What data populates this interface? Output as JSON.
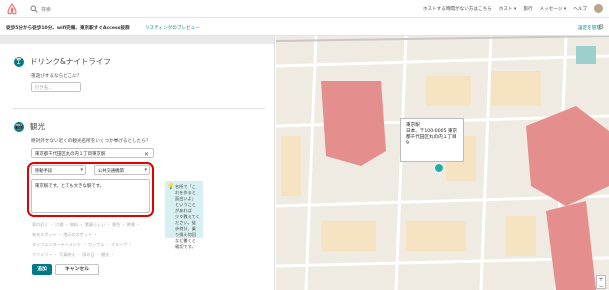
{
  "nav": {
    "search_placeholder": "検索",
    "links": [
      "ホストする時間がない方はこちら",
      "ホスト ▾",
      "旅行",
      "メッセージ ▾",
      "ヘルプ"
    ]
  },
  "subbar": {
    "listing_title": "徒歩5分から徒歩10分、wifi完備、東京駅すぐAccess抜群",
    "preview_link": "リスティングのプレビュー",
    "settings_link": "設定を管理"
  },
  "drinks": {
    "title": "ドリンク&ナイトライフ",
    "question": "夜遊びするならどこに？",
    "input_placeholder": "行き先..."
  },
  "sightseeing": {
    "title": "観光",
    "question": "絶対外せない近くの観光名所をいくつか挙げるとしたら？",
    "place_value": "東京都千代田区丸の内１丁目東京駅",
    "clear_icon": "✕",
    "transport_select": "移動手段",
    "transport_mode_select": "公共交通機関",
    "description_text": "東京駅です。とても大きな駅です。",
    "tip_text": "名所で「これを作ると面白いよ」ということがあれば少々教えてください。徒歩何分、乗り換え何回など書くと親切です。"
  },
  "tags": [
    "家の近く ・ 穴場 ・ 無料 ・ 素晴らしい ・ 景色 ・ 絶景 ・",
    "有名スポット ・ 地元のスポット ・",
    "ライブエンターテイメント ・ カップル ・ グループ ・",
    "ファミリー ・ 写真映え ・ 雨の日 ・ 観光 ・"
  ],
  "buttons": {
    "add": "追加",
    "cancel": "キャンセル"
  },
  "map": {
    "popup_title": "東京駅",
    "popup_line1": "日本、〒100-0005 東京",
    "popup_line2": "都千代田区丸の内１丁目",
    "popup_line3": "9",
    "zoom_in": "+",
    "zoom_out": "−"
  },
  "colors": {
    "accent": "#007a87",
    "highlight": "#e00000",
    "map_red_building": "#e58e8e",
    "map_bg": "#efeae2"
  }
}
